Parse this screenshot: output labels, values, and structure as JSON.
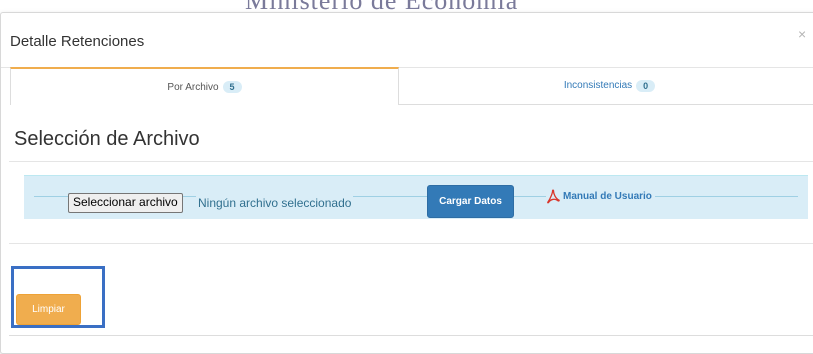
{
  "background_title": "Ministerio de Economia",
  "modal": {
    "title": "Detalle Retenciones",
    "close_symbol": "×"
  },
  "tabs": [
    {
      "label": "Por Archivo",
      "count": "5",
      "active": true
    },
    {
      "label": "Inconsistencias",
      "count": "0",
      "active": false
    }
  ],
  "section": {
    "title": "Selección de Archivo"
  },
  "upload": {
    "file_button_label": "Seleccionar archivo",
    "file_status": "Ningún archivo seleccionado",
    "load_button_label": "Cargar Datos",
    "manual_link_label": "Manual de Usuario",
    "manual_icon": "pdf-icon"
  },
  "actions": {
    "clear_label": "Limpiar"
  },
  "colors": {
    "primary": "#337ab7",
    "warning": "#f0ad4e",
    "info_bg": "#d9edf7",
    "highlight_border": "#3a6fc4"
  }
}
